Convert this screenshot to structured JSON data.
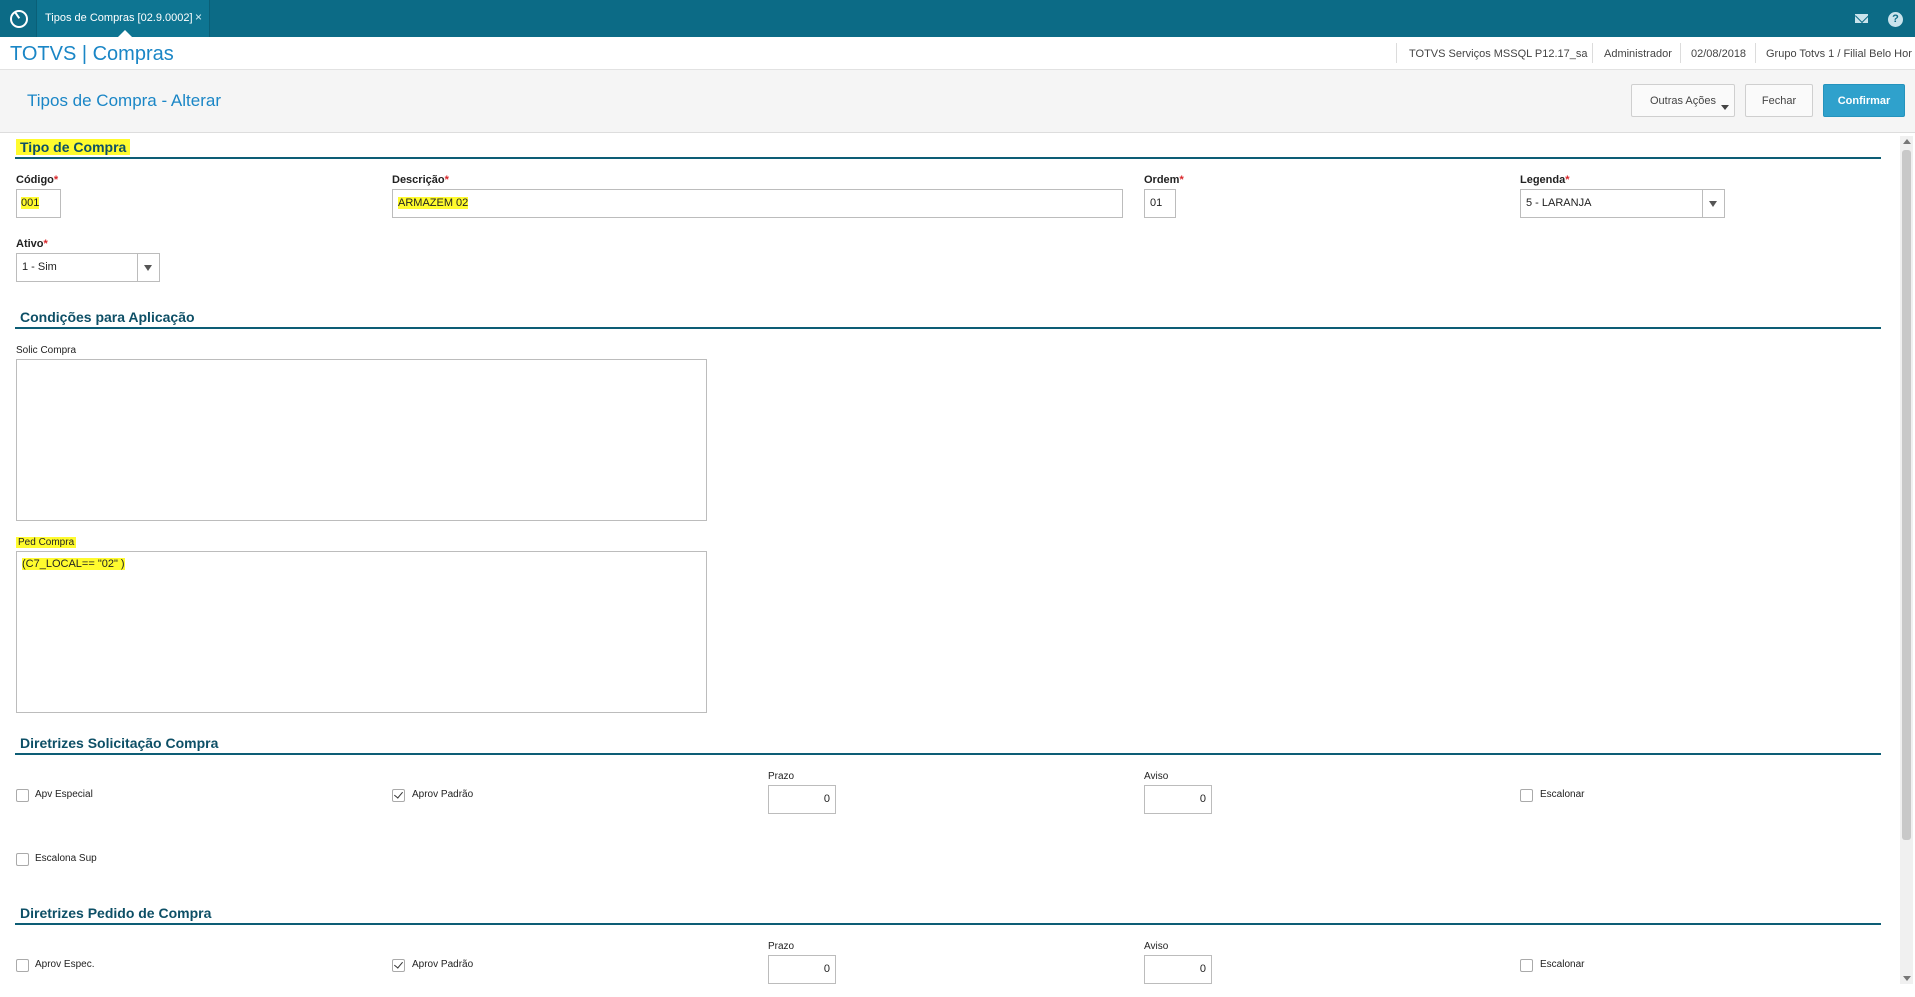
{
  "window": {
    "tab_title": "Tipos de Compras [02.9.0002]",
    "tab_close": "×",
    "app_title": "TOTVS | Compras",
    "icons": [
      "totvs-logo-icon",
      "mail-icon",
      "help-icon"
    ]
  },
  "topinfo": {
    "server": "TOTVS Serviços MSSQL P12.17_sa",
    "user": "Administrador",
    "date": "02/08/2018",
    "branch": "Grupo Totvs 1 / Filial Belo Hor"
  },
  "header": {
    "page_title": "Tipos de Compra - Alterar",
    "btn_outras": "Outras Ações",
    "btn_fechar": "Fechar",
    "btn_confirmar": "Confirmar"
  },
  "tipo_compra": {
    "section_title": "Tipo de Compra",
    "codigo_label": "Código",
    "codigo_value": "001",
    "descricao_label": "Descrição",
    "descricao_value": "ARMAZEM 02",
    "ordem_label": "Ordem",
    "ordem_value": "01",
    "legenda_label": "Legenda",
    "legenda_value": "5 - LARANJA",
    "ativo_label": "Ativo",
    "ativo_value": "1 - Sim",
    "required_mark": "*"
  },
  "condicoes": {
    "section_title": "Condições para Aplicação",
    "solic_label": "Solic Compra",
    "solic_value": "",
    "ped_label": "Ped Compra",
    "ped_value": "(C7_LOCAL== \"02\" )"
  },
  "diretrizes_solic": {
    "section_title": "Diretrizes Solicitação Compra",
    "apv_especial": "Apv Especial",
    "apv_especial_checked": false,
    "aprov_padrao": "Aprov Padrão",
    "aprov_padrao_checked": true,
    "prazo_label": "Prazo",
    "prazo_value": "0",
    "aviso_label": "Aviso",
    "aviso_value": "0",
    "escalonar": "Escalonar",
    "escalonar_checked": false,
    "escalona_sup": "Escalona Sup",
    "escalona_sup_checked": false
  },
  "diretrizes_pedido": {
    "section_title": "Diretrizes Pedido de Compra",
    "aprov_espec": "Aprov Espec.",
    "aprov_espec_checked": false,
    "aprov_padrao": "Aprov Padrão",
    "aprov_padrao_checked": true,
    "prazo_label": "Prazo",
    "prazo_value": "0",
    "aviso_label": "Aviso",
    "aviso_value": "0",
    "escalonar": "Escalonar",
    "escalonar_checked": false
  },
  "colors": {
    "topbar": "#0c6b86",
    "accent_blue": "#1a86c6",
    "primary_button": "#2fa1cc",
    "section_title": "#0d4f66",
    "highlight": "#fffb2e",
    "required": "#d9262a"
  }
}
